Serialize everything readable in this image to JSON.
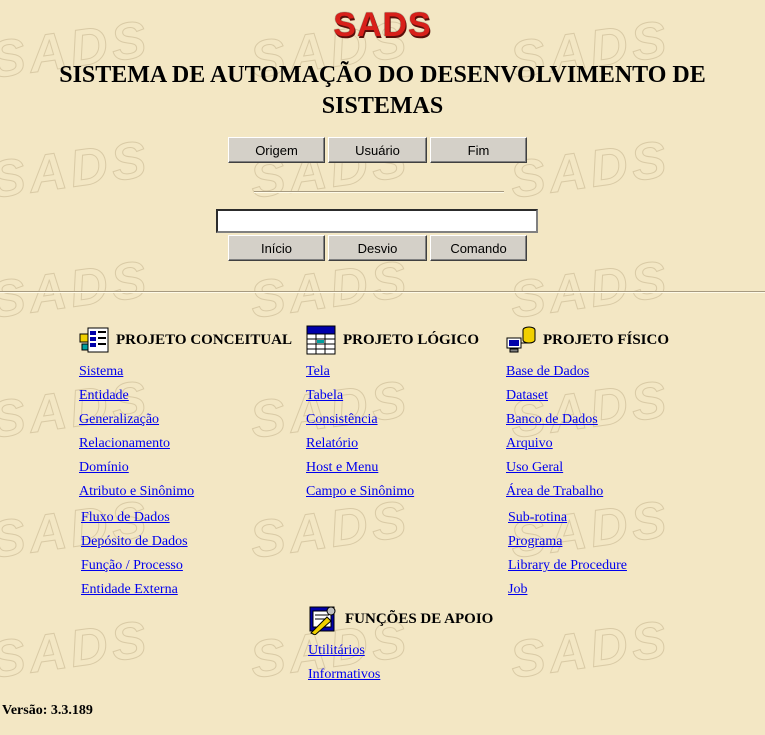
{
  "logo": "SADS",
  "title": "SISTEMA DE AUTOMAÇÃO DO DESENVOLVIMENTO DE SISTEMAS",
  "top_buttons": [
    "Origem",
    "Usuário",
    "Fim"
  ],
  "command_input": {
    "value": ""
  },
  "bottom_buttons": [
    "Início",
    "Desvio",
    "Comando"
  ],
  "sections": {
    "conceitual": {
      "heading": "PROJETO CONCEITUAL",
      "icon": "diagram-icon",
      "links": [
        "Sistema",
        "Entidade",
        "Generalização",
        "Relacionamento",
        "Domínio",
        "Atributo e Sinônimo",
        "Fluxo de Dados",
        "Depósito de Dados",
        "Função / Processo",
        "Entidade Externa"
      ]
    },
    "logico": {
      "heading": "PROJETO LÓGICO",
      "icon": "table-icon",
      "links": [
        "Tela",
        "Tabela",
        "Consistência",
        "Relatório",
        "Host e Menu",
        "Campo e Sinônimo"
      ]
    },
    "fisico": {
      "heading": "PROJETO FÍSICO",
      "icon": "database-icon",
      "links": [
        "Base de Dados",
        "Dataset",
        "Banco de Dados",
        "Arquivo",
        "Uso Geral",
        "Área de Trabalho",
        "Sub-rotina",
        "Programa",
        "Library de Procedure",
        "Job"
      ]
    },
    "apoio": {
      "heading": "FUNÇÕES DE APOIO",
      "icon": "tools-icon",
      "links": [
        "Utilitários",
        "Informativos"
      ]
    }
  },
  "version": "Versão: 3.3.189",
  "colors": {
    "background": "#f3e7c4",
    "logo": "#d8201a",
    "link": "#0000ee",
    "button": "#d4d0c8"
  }
}
